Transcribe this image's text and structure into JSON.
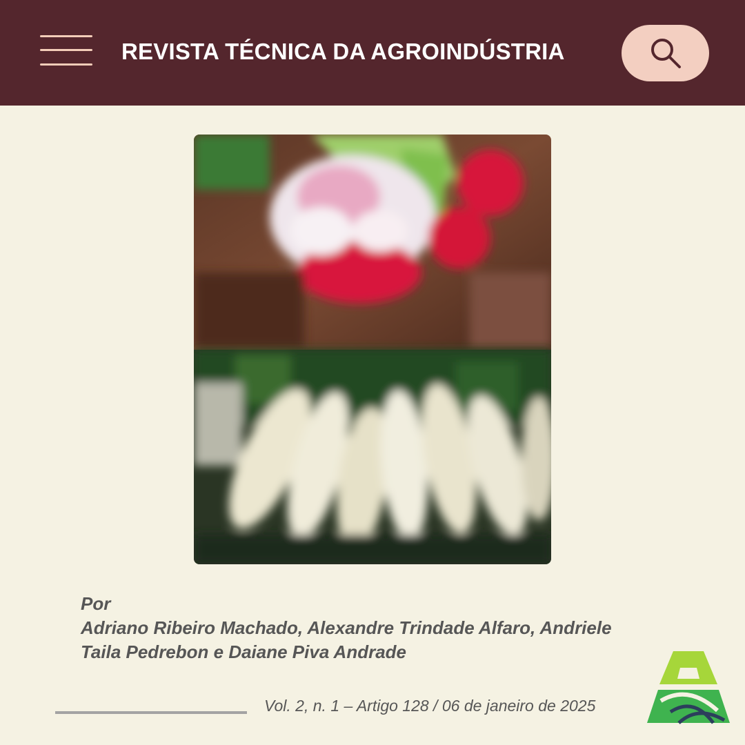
{
  "header": {
    "title": "REVISTA TÉCNICA DA AGROINDÚSTRIA",
    "menu_icon": "hamburger-menu-icon",
    "search_icon": "search-icon"
  },
  "hero": {
    "description_icon": "radish-photo"
  },
  "byline": {
    "prefix": "Por",
    "authors_line1": "Adriano Ribeiro Machado, Alexandre Trindade Alfaro, Andriele",
    "authors_line2": "Taila Pedrebon e Daiane Piva Andrade"
  },
  "footer": {
    "citation": "Vol. 2, n. 1 – Artigo 128 / 06 de janeiro de 2025",
    "logo_icon": "agroindustria-logo"
  },
  "colors": {
    "header_bg": "#54262d",
    "page_bg": "#f5f2e3",
    "accent_pink": "#f3cfc1",
    "logo_green": "#3fb34f",
    "logo_lime": "#a6d63a",
    "logo_navy": "#2c3e5c"
  }
}
